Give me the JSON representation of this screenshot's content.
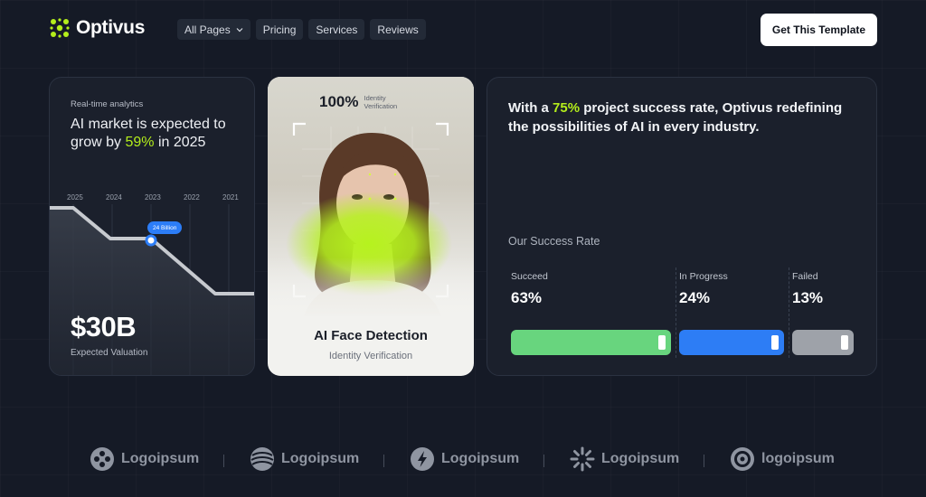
{
  "brand": {
    "name": "Optivus",
    "accent": "#b4ee1b"
  },
  "nav": {
    "links": [
      {
        "label": "All Pages",
        "has_dropdown": true
      },
      {
        "label": "Pricing"
      },
      {
        "label": "Services"
      },
      {
        "label": "Reviews"
      }
    ],
    "cta_label": "Get This Template"
  },
  "analytics": {
    "kicker": "Real-time analytics",
    "headline_pre": "AI market is expected to grow by ",
    "headline_accent": "59%",
    "headline_post": " in 2025",
    "years": [
      "2025",
      "2024",
      "2023",
      "2022",
      "2021"
    ],
    "bubble": "24 Billion",
    "value": "$30B",
    "value_label": "Expected Valuation"
  },
  "face": {
    "percent": "100%",
    "percent_label_1": "Identity",
    "percent_label_2": "Verification",
    "title": "AI Face Detection",
    "subtitle": "Identity Verification"
  },
  "success": {
    "headline_pre": "With a ",
    "headline_accent": "75%",
    "headline_post": " project success rate, Optivus redefining the possibilities of AI in every industry.",
    "label": "Our Success Rate",
    "segments": [
      {
        "name": "Succeed",
        "value": "63%",
        "color": "#68d57e"
      },
      {
        "name": "In Progress",
        "value": "24%",
        "color": "#2d7df5"
      },
      {
        "name": "Failed",
        "value": "13%",
        "color": "#9ea2a9"
      }
    ]
  },
  "logos": [
    {
      "label": "Logoipsum",
      "icon": "circle-dots-icon"
    },
    {
      "label": "Logoipsum",
      "icon": "wave-globe-icon"
    },
    {
      "label": "Logoipsum",
      "icon": "bolt-circle-icon"
    },
    {
      "label": "Logoipsum",
      "icon": "sunburst-icon"
    },
    {
      "label": "logoipsum",
      "icon": "ring-circle-icon"
    }
  ]
}
